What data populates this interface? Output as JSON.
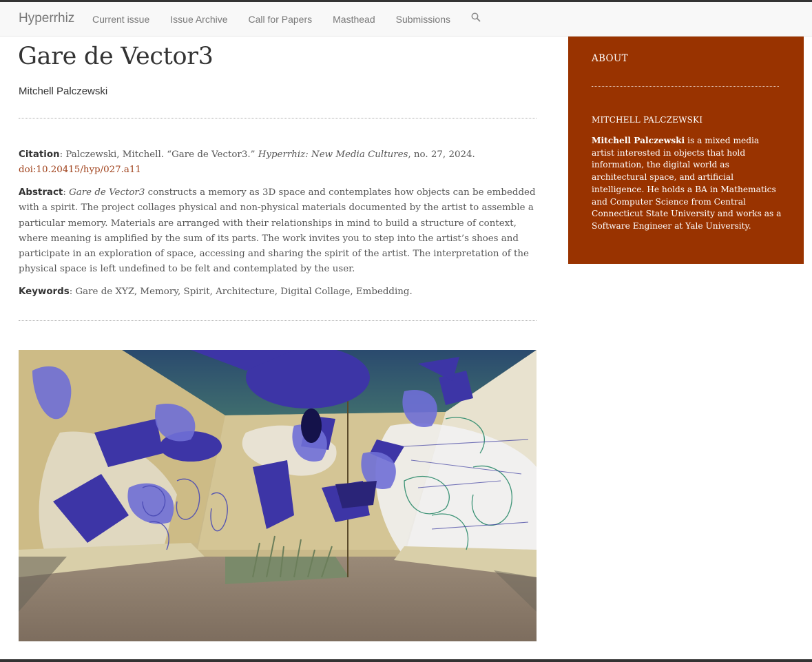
{
  "header": {
    "brand": "Hyperrhiz",
    "nav": [
      "Current issue",
      "Issue Archive",
      "Call for Papers",
      "Masthead",
      "Submissions"
    ],
    "search_icon": "search-icon"
  },
  "article": {
    "title": "Gare de Vector3",
    "author": "Mitchell Palczewski",
    "citation": {
      "label": "Citation",
      "text_before": ": Palczewski, Mitchell. “Gare de Vector3.” ",
      "journal": "Hyperrhiz: New Media Cultures",
      "text_after": ", no. 27, 2024.",
      "doi": "doi:10.20415/hyp/027.a11"
    },
    "abstract": {
      "label": "Abstract",
      "colon": ": ",
      "title_italic": "Gare de Vector3",
      "text": " constructs a memory as 3D space and contemplates how objects can be embedded with a spirit. The project collages physical and non-physical materials documented by the artist to assemble a particular memory. Materials are arranged with their relationships in mind to build a structure of context, where meaning is amplified by the sum of its parts. The work invites you to step into the artist’s shoes and participate in an exploration of space, accessing and sharing the spirit of the artist. The interpretation of the physical space is left undefined to be felt and contemplated by the user."
    },
    "keywords": {
      "label": "Keywords",
      "text": ": Gare de XYZ, Memory, Spirit, Architecture, Digital Collage, Embedding."
    }
  },
  "sidebar": {
    "title": "ABOUT",
    "bio_heading": "MITCHELL PALCZEWSKI",
    "bio_name": "Mitchell Palczewski",
    "bio_text": " is a mixed media artist interested in objects that hold information, the digital world as architectural space, and artificial intelligence. He holds a BA in Mathematics and Computer Science from Central Connecticut State University and works as a Software Engineer at Yale University."
  },
  "colors": {
    "sidebar_bg": "#993300",
    "link": "#a0421c",
    "navbar_bg": "#f8f8f8"
  }
}
